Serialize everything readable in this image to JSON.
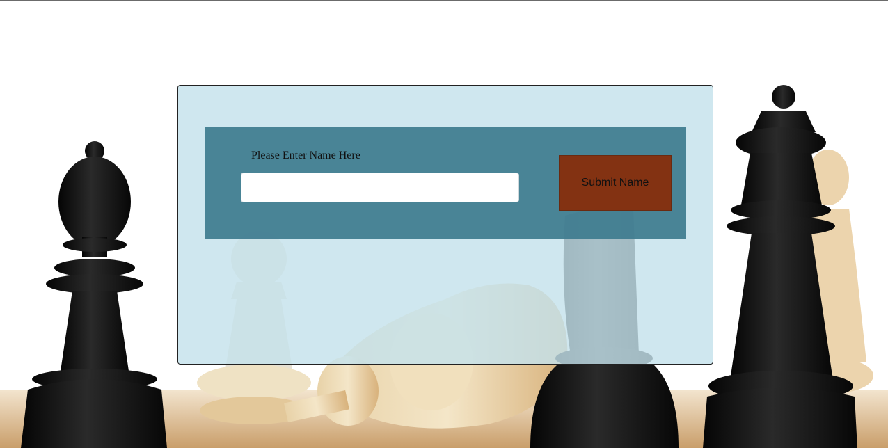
{
  "form": {
    "name_label": "Please Enter Name Here",
    "name_value": "",
    "name_placeholder": "",
    "submit_label": "Submit Name"
  },
  "colors": {
    "panel_bg": "#cfe6ee",
    "form_bar_bg": "#4b8799",
    "submit_bg": "#833212",
    "board": "#d9b88c"
  },
  "background": {
    "subject": "chess-pieces-photo"
  }
}
